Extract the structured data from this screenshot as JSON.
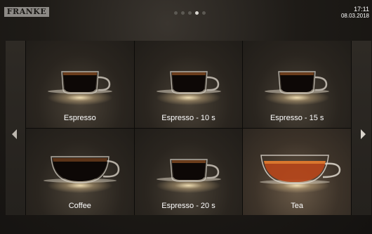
{
  "header": {
    "brand_logo": "FRANKE",
    "page_indicator": {
      "total": 5,
      "active_index": 3
    },
    "clock": {
      "time": "17:11",
      "date": "08.03.2018"
    }
  },
  "navigation": {
    "prev_icon": "chevron-left-icon",
    "next_icon": "chevron-right-icon"
  },
  "products": [
    {
      "label": "Espresso",
      "cup": "espresso-cup"
    },
    {
      "label": "Espresso - 10 s",
      "cup": "espresso-cup"
    },
    {
      "label": "Espresso - 15 s",
      "cup": "espresso-cup"
    },
    {
      "label": "Coffee",
      "cup": "coffee-cup"
    },
    {
      "label": "Espresso - 20 s",
      "cup": "espresso-cup"
    },
    {
      "label": "Tea",
      "cup": "tea-cup"
    }
  ]
}
